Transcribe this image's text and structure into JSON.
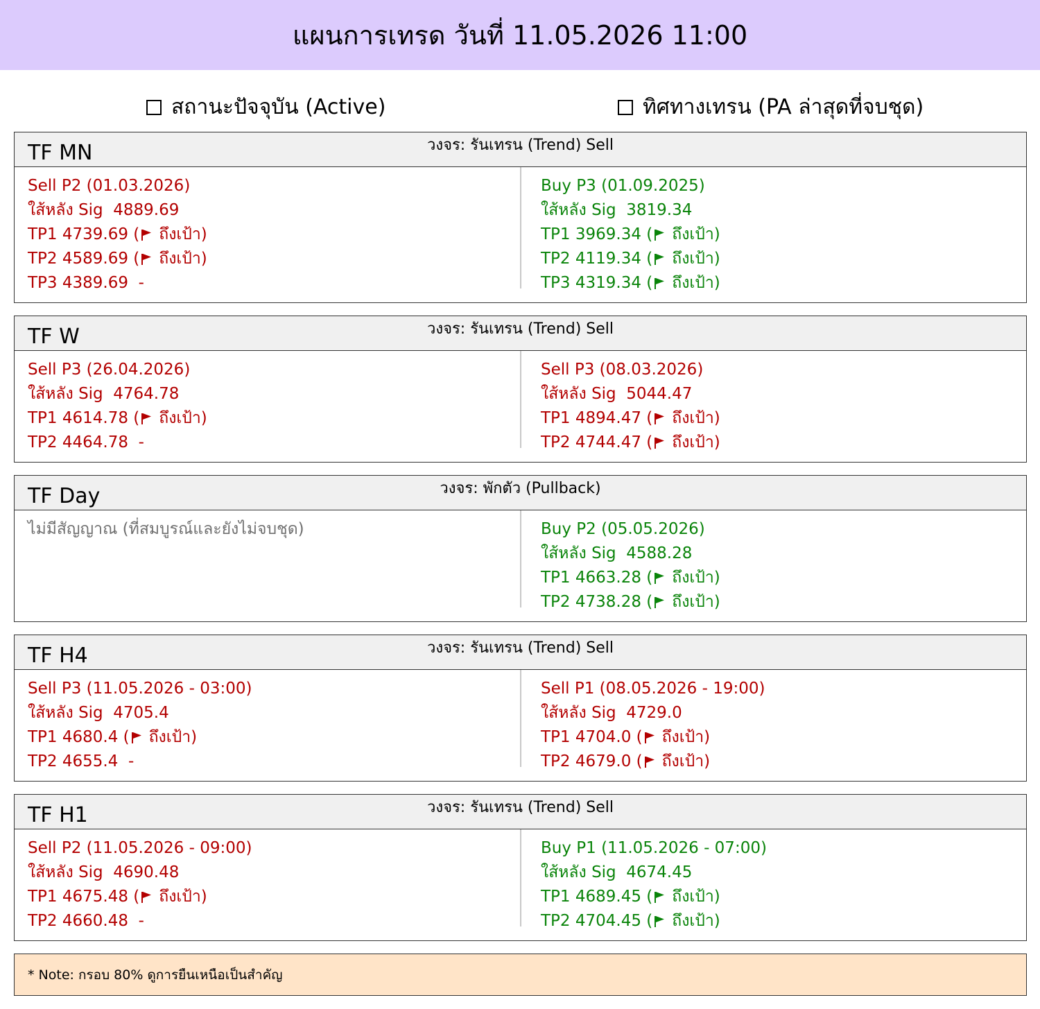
{
  "header": {
    "title": "แผนการเทรด วันที่ 11.05.2026 11:00"
  },
  "legend": {
    "left_label": "สถานะปัจจุบัน (Active)",
    "right_label": "ทิศทางเทรน (PA ล่าสุดที่จบชุด)"
  },
  "colors": {
    "sell": "#b30000",
    "buy": "#0a840a",
    "none": "#707070",
    "header_bg": "#dccbfd",
    "note_bg": "#ffe4c8"
  },
  "icons": {
    "flag": "flag-icon",
    "checkbox": "checkbox-icon"
  },
  "panels": [
    {
      "tf": "TF MN",
      "cycle": "วงจร: รันเทรน (Trend) Sell",
      "left": {
        "type": "sell",
        "lines": [
          {
            "text": "Sell P2 (01.03.2026)"
          },
          {
            "text": "ใส้หลัง Sig  4889.69"
          },
          {
            "text": "TP1 4739.69 (",
            "flag": true,
            "after": "ถึงเป้า)"
          },
          {
            "text": "TP2 4589.69 (",
            "flag": true,
            "after": "ถึงเป้า)"
          },
          {
            "text": "TP3 4389.69  -"
          }
        ]
      },
      "right": {
        "type": "buy",
        "lines": [
          {
            "text": "Buy P3 (01.09.2025)"
          },
          {
            "text": "ใส้หลัง Sig  3819.34"
          },
          {
            "text": "TP1 3969.34 (",
            "flag": true,
            "after": "ถึงเป้า)"
          },
          {
            "text": "TP2 4119.34 (",
            "flag": true,
            "after": "ถึงเป้า)"
          },
          {
            "text": "TP3 4319.34 (",
            "flag": true,
            "after": "ถึงเป้า)"
          }
        ]
      }
    },
    {
      "tf": "TF W",
      "cycle": "วงจร: รันเทรน (Trend) Sell",
      "left": {
        "type": "sell",
        "lines": [
          {
            "text": "Sell P3 (26.04.2026)"
          },
          {
            "text": "ใส้หลัง Sig  4764.78"
          },
          {
            "text": "TP1 4614.78 (",
            "flag": true,
            "after": "ถึงเป้า)"
          },
          {
            "text": "TP2 4464.78  -"
          }
        ]
      },
      "right": {
        "type": "sell",
        "lines": [
          {
            "text": "Sell P3 (08.03.2026)"
          },
          {
            "text": "ใส้หลัง Sig  5044.47"
          },
          {
            "text": "TP1 4894.47 (",
            "flag": true,
            "after": "ถึงเป้า)"
          },
          {
            "text": "TP2 4744.47 (",
            "flag": true,
            "after": "ถึงเป้า)"
          }
        ]
      }
    },
    {
      "tf": "TF Day",
      "cycle": "วงจร: พักตัว (Pullback)",
      "left": {
        "type": "none",
        "lines": [
          {
            "text": "ไม่มีสัญญาณ (ที่สมบูรณ์และยังไม่จบชุด)"
          }
        ]
      },
      "right": {
        "type": "buy",
        "lines": [
          {
            "text": "Buy P2 (05.05.2026)"
          },
          {
            "text": "ใส้หลัง Sig  4588.28"
          },
          {
            "text": "TP1 4663.28 (",
            "flag": true,
            "after": "ถึงเป้า)"
          },
          {
            "text": "TP2 4738.28 (",
            "flag": true,
            "after": "ถึงเป้า)"
          }
        ]
      }
    },
    {
      "tf": "TF H4",
      "cycle": "วงจร: รันเทรน (Trend) Sell",
      "left": {
        "type": "sell",
        "lines": [
          {
            "text": "Sell P3 (11.05.2026 - 03:00)"
          },
          {
            "text": "ใส้หลัง Sig  4705.4"
          },
          {
            "text": "TP1 4680.4 (",
            "flag": true,
            "after": "ถึงเป้า)"
          },
          {
            "text": "TP2 4655.4  -"
          }
        ]
      },
      "right": {
        "type": "sell",
        "lines": [
          {
            "text": "Sell P1 (08.05.2026 - 19:00)"
          },
          {
            "text": "ใส้หลัง Sig  4729.0"
          },
          {
            "text": "TP1 4704.0 (",
            "flag": true,
            "after": "ถึงเป้า)"
          },
          {
            "text": "TP2 4679.0 (",
            "flag": true,
            "after": "ถึงเป้า)"
          }
        ]
      }
    },
    {
      "tf": "TF H1",
      "cycle": "วงจร: รันเทรน (Trend) Sell",
      "left": {
        "type": "sell",
        "lines": [
          {
            "text": "Sell P2 (11.05.2026 - 09:00)"
          },
          {
            "text": "ใส้หลัง Sig  4690.48"
          },
          {
            "text": "TP1 4675.48 (",
            "flag": true,
            "after": "ถึงเป้า)"
          },
          {
            "text": "TP2 4660.48  -"
          }
        ]
      },
      "right": {
        "type": "buy",
        "lines": [
          {
            "text": "Buy P1 (11.05.2026 - 07:00)"
          },
          {
            "text": "ใส้หลัง Sig  4674.45"
          },
          {
            "text": "TP1 4689.45 (",
            "flag": true,
            "after": "ถึงเป้า)"
          },
          {
            "text": "TP2 4704.45 (",
            "flag": true,
            "after": "ถึงเป้า)"
          }
        ]
      }
    }
  ],
  "note": {
    "text": "* Note: กรอบ 80% ดูการยืนเหนือเป็นสำคัญ"
  }
}
